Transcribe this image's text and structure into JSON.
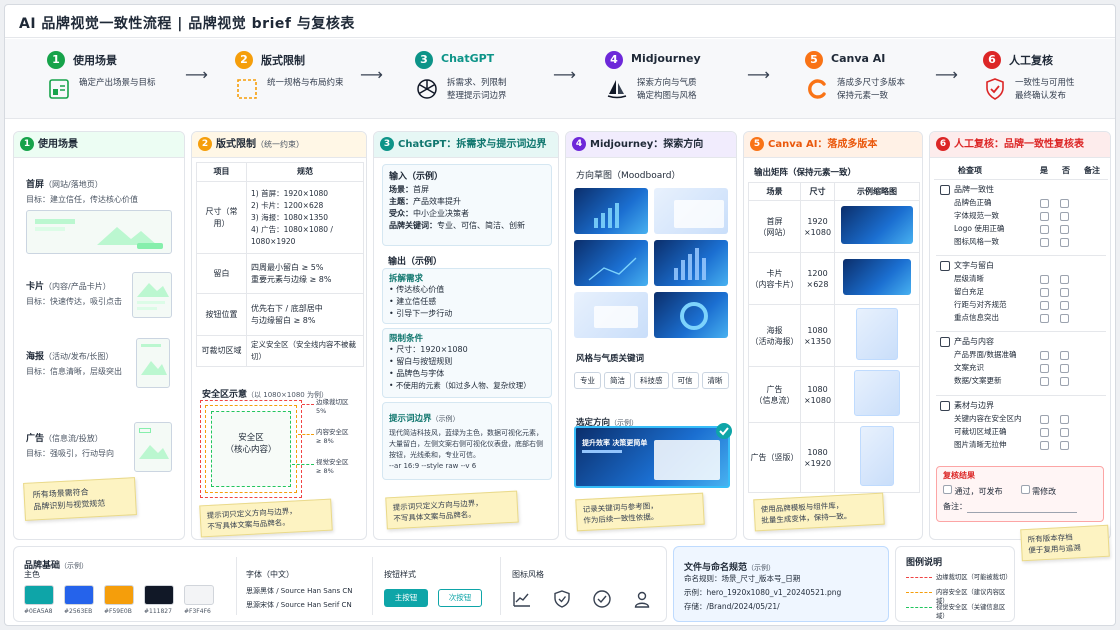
{
  "title": "AI 品牌视觉一致性流程 | 品牌视觉 brief 与复核表",
  "steps": [
    {
      "num": "1",
      "title": "使用场景",
      "desc": "确定产出场景与目标",
      "color": "#16a34a"
    },
    {
      "num": "2",
      "title": "版式限制",
      "desc": "统一规格与布局约束",
      "color": "#f59e0b"
    },
    {
      "num": "3",
      "title": "ChatGPT",
      "desc": "拆需求、列限制\n整理提示词边界",
      "color": "#0d9488"
    },
    {
      "num": "4",
      "title": "Midjourney",
      "desc": "探索方向与气质\n确定构图与风格",
      "color": "#6d28d9"
    },
    {
      "num": "5",
      "title": "Canva AI",
      "desc": "落成多尺寸多版本\n保持元素一致",
      "color": "#f97316"
    },
    {
      "num": "6",
      "title": "人工复核",
      "desc": "一致性与可用性\n最终确认发布",
      "color": "#dc2626"
    }
  ],
  "col1": {
    "title": "使用场景",
    "scenes": [
      {
        "name": "首屏",
        "sub": "（网站/落地页）",
        "goal": "目标：建立信任，传达核心价值"
      },
      {
        "name": "卡片",
        "sub": "（内容/产品卡片）",
        "goal": "目标：快速传达，吸引点击"
      },
      {
        "name": "海报",
        "sub": "（活动/发布/长图）",
        "goal": "目标：信息清晰，层级突出"
      },
      {
        "name": "广告",
        "sub": "（信息流/投放）",
        "goal": "目标：强吸引，行动导向"
      }
    ],
    "note": "所有场景需符合\n品牌识别与视觉规范"
  },
  "col2": {
    "title": "版式限制",
    "title_sub": "（统一约束）",
    "th_item": "项目",
    "th_spec": "规范",
    "rows": [
      {
        "item": "尺寸（常用）",
        "spec": "1) 首屏：1920×1080\n2) 卡片：1200×628\n3) 海报：1080×1350\n4) 广告：1080×1080 / 1080×1920"
      },
      {
        "item": "留白",
        "spec": "四周最小留白 ≥ 5%\n重要元素与边缘 ≥ 8%"
      },
      {
        "item": "按钮位置",
        "spec": "优先右下 / 底部居中\n与边缘留白 ≥ 8%"
      },
      {
        "item": "可裁切区域",
        "spec": "定义安全区（安全线内容不被裁切）"
      }
    ],
    "safe_title": "安全区示意",
    "safe_sub": "（以 1080×1080 为例）",
    "safe_center": "安全区\n（核心内容）",
    "safe_labels": [
      "边缘裁切区\n5%",
      "内容安全区\n≥ 8%",
      "视觉安全区\n≥ 8%"
    ],
    "note": "提示词只定义方向与边界，\n不写具体文案与品牌名。"
  },
  "col3": {
    "title": "ChatGPT：拆需求与提示词边界",
    "input_title": "输入（示例）",
    "inputs": [
      {
        "k": "场景：",
        "v": "首屏"
      },
      {
        "k": "主题：",
        "v": "产品效率提升"
      },
      {
        "k": "受众：",
        "v": "中小企业决策者"
      },
      {
        "k": "品牌关键词：",
        "v": "专业、可信、简洁、创新"
      }
    ],
    "output_title": "输出（示例）",
    "split_title": "拆解需求",
    "split": [
      "传达核心价值",
      "建立信任感",
      "引导下一步行动"
    ],
    "limit_title": "限制条件",
    "limits": [
      "尺寸：1920×1080",
      "留白与按钮规则",
      "品牌色与字体",
      "不使用的元素（如过多人物、复杂纹理）"
    ],
    "prompt_title": "提示词边界",
    "prompt_sub": "（示例）",
    "prompt": "现代简洁科技风，蓝绿为主色，数据可视化元素，大量留白，左侧文案右侧可视化仪表盘，底部右侧按钮，光线柔和，专业可信。\n--ar 16:9 --style raw --v 6"
  },
  "col4": {
    "title": "Midjourney：探索方向",
    "mood_title": "方向草图（Moodboard）",
    "kw_title": "风格与气质关键词",
    "keywords": [
      "专业",
      "简洁",
      "科技感",
      "可信",
      "清晰"
    ],
    "sel_title": "选定方向",
    "sel_sub": "（示例）",
    "banner_title": "提升效率 决策更简单",
    "note": "记录关键词与参考图，\n作为后续一致性依据。"
  },
  "col5": {
    "title": "Canva AI：落成多版本",
    "matrix_title": "输出矩阵（保持元素一致）",
    "headers": [
      "场景",
      "尺寸",
      "示例缩略图"
    ],
    "rows": [
      {
        "scene": "首屏\n（网站）",
        "size": "1920\n×1080"
      },
      {
        "scene": "卡片\n（内容卡片）",
        "size": "1200\n×628"
      },
      {
        "scene": "海报\n（活动海报）",
        "size": "1080\n×1350"
      },
      {
        "scene": "广告\n（信息流）",
        "size": "1080\n×1080"
      },
      {
        "scene": "广告（竖版）",
        "size": "1080\n×1920"
      }
    ],
    "note": "使用品牌模板与组件库，\n批量生成变体，保持一致。"
  },
  "col6": {
    "title": "人工复核：品牌一致性复核表",
    "headers": [
      "检查项",
      "是",
      "否",
      "备注"
    ],
    "groups": [
      {
        "name": "品牌一致性",
        "icon": "chart-icon",
        "items": [
          "品牌色正确",
          "字体规范一致",
          "Logo 使用正确",
          "图标风格一致"
        ]
      },
      {
        "name": "文字与留白",
        "icon": "check-square-icon",
        "items": [
          "层级清晰",
          "留白充足",
          "行距与对齐规范",
          "重点信息突出"
        ]
      },
      {
        "name": "产品与内容",
        "icon": "check-circle-icon",
        "items": [
          "产品界面/数据准确",
          "文案充识",
          "数据/文案更新"
        ]
      },
      {
        "name": "素材与边界",
        "icon": "image-icon",
        "items": [
          "关键内容在安全区内",
          "可裁切区域正确",
          "图片清晰无拉伸"
        ]
      }
    ],
    "result_title": "复核结果",
    "pass": "通过，可发布",
    "revise": "需修改",
    "remark": "备注：",
    "note": "所有版本存档\n便于复用与追溯"
  },
  "brand": {
    "title": "品牌基础",
    "title_sub": "（示例）",
    "primary": "主色",
    "colors": [
      {
        "hex": "#0EA5A8",
        "label": "#0EA5A8"
      },
      {
        "hex": "#2563EB",
        "label": "#2563EB"
      },
      {
        "hex": "#F59E0B",
        "label": "#F59E0B"
      },
      {
        "hex": "#111827",
        "label": "#111827"
      },
      {
        "hex": "#F3F4F6",
        "label": "#F3F4F6"
      }
    ],
    "font_title": "字体（中文）",
    "fonts": [
      "思源黑体 / Source Han Sans CN",
      "思源宋体 / Source Han Serif CN"
    ],
    "btn_title": "按钮样式",
    "btn_primary": "主按钮",
    "btn_secondary": "次按钮",
    "icon_title": "图标风格"
  },
  "file": {
    "title": "文件与命名规范",
    "title_sub": "（示例）",
    "rows": [
      {
        "k": "命名规则：",
        "v": "场景_尺寸_版本号_日期"
      },
      {
        "k": "示例：",
        "v": "hero_1920x1080_v1_20240521.png"
      },
      {
        "k": "存储：",
        "v": "/Brand/2024/05/21/"
      }
    ]
  },
  "legend": {
    "title": "图例说明",
    "items": [
      {
        "label": "边缘裁切区（可能被裁切）",
        "color": "#ef4444"
      },
      {
        "label": "内容安全区（建议内容区域）",
        "color": "#f59e0b"
      },
      {
        "label": "视觉安全区（关键信息区域）",
        "color": "#22c55e"
      }
    ]
  }
}
